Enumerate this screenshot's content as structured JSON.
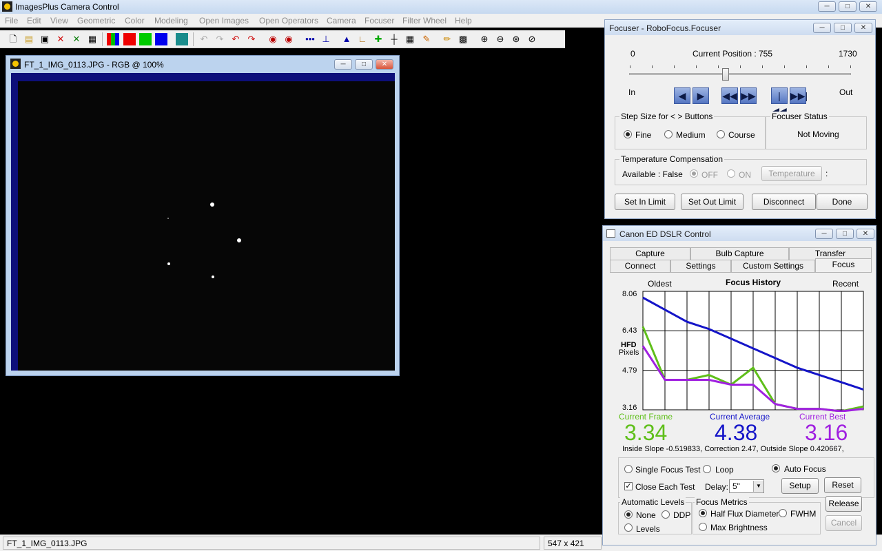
{
  "app": {
    "title": "ImagesPlus Camera Control"
  },
  "menu": [
    "File",
    "Edit",
    "View",
    "Geometric",
    "Color",
    "Modeling",
    "Open Images",
    "Open Operators",
    "Camera",
    "Focuser",
    "Filter Wheel",
    "Help"
  ],
  "toolbar": {
    "icons": [
      "new-file-icon",
      "open-folder-icon",
      "save-icon",
      "close-red-x-icon",
      "close-green-x-icon",
      "window-icon",
      "rgb-channels-icon",
      "red-channel-icon",
      "green-channel-icon",
      "blue-channel-icon",
      "stack-icon",
      "undo-gray-icon",
      "redo-gray-icon",
      "undo-icon",
      "redo-icon",
      "star-target-icon",
      "star-target-alt-icon",
      "dots-icon",
      "plot-icon",
      "histogram-icon",
      "curve-icon",
      "add-green-icon",
      "crosshair-icon",
      "grid-select-icon",
      "paint-icon",
      "pencil-icon",
      "calculator-icon",
      "zoom-in-icon",
      "zoom-out-icon",
      "zoom-fit-icon",
      "zoom-actual-icon"
    ]
  },
  "image_window": {
    "title": "FT_1_IMG_0113.JPG - RGB @ 100%"
  },
  "status": {
    "filename": "FT_1_IMG_0113.JPG",
    "dimensions": "547 x 421"
  },
  "focuser": {
    "title": "Focuser - RoboFocus.Focuser",
    "min": "0",
    "max": "1730",
    "current_label": "Current Position :",
    "current_value": "755",
    "position_fraction": 0.436,
    "in_label": "In",
    "out_label": "Out",
    "step_group": "Step Size for < > Buttons",
    "step_options": [
      "Fine",
      "Medium",
      "Course"
    ],
    "step_selected": "Fine",
    "status_group": "Focuser Status",
    "status_value": "Not Moving",
    "temp_group": "Temperature Compensation",
    "temp_available": "Available : False",
    "temp_off": "OFF",
    "temp_on": "ON",
    "temp_button": "Temperature",
    "temp_colon": ":",
    "buttons": {
      "set_in": "Set In Limit",
      "set_out": "Set Out Limit",
      "disconnect": "Disconnect",
      "done": "Done"
    }
  },
  "dslr": {
    "title": "Canon ED DSLR Control",
    "tabs_row1": [
      "Capture",
      "Bulb Capture",
      "Transfer"
    ],
    "tabs_row2": [
      "Connect",
      "Settings",
      "Custom Settings",
      "Focus"
    ],
    "active_tab": "Focus",
    "oldest": "Oldest",
    "recent": "Recent",
    "current_frame_label": "Current Frame",
    "current_frame_value": "3.34",
    "current_avg_label": "Current Average",
    "current_avg_value": "4.38",
    "current_best_label": "Current Best",
    "current_best_value": "3.16",
    "slope_text": "Inside Slope -0.519833, Correction  2.47, Outside Slope 0.420667,",
    "single_focus": "Single Focus Test",
    "loop": "Loop",
    "auto_focus": "Auto Focus",
    "close_each": "Close Each Test",
    "delay_label": "Delay:",
    "delay_value": "5\"",
    "setup": "Setup",
    "reset": "Reset",
    "release": "Release",
    "cancel": "Cancel",
    "auto_levels_group": "Automatic Levels",
    "auto_levels": [
      "None",
      "DDP",
      "Levels"
    ],
    "auto_levels_selected": "None",
    "metrics_group": "Focus Metrics",
    "metrics": [
      "Half Flux Diameter",
      "FWHM",
      "Max Brightness"
    ],
    "metrics_selected": "Half Flux Diameter",
    "colors": {
      "frame": "#5fbf1a",
      "average": "#1515c8",
      "best": "#a020e0"
    }
  },
  "chart_data": {
    "type": "line",
    "title": "Focus History",
    "ylabel_line1": "HFD",
    "ylabel_line2": "Pixels",
    "yticks": [
      "8.06",
      "6.43",
      "4.79",
      "3.16"
    ],
    "ylim": [
      3.16,
      8.06
    ],
    "x": [
      0,
      1,
      2,
      3,
      4,
      5,
      6,
      7,
      8,
      9,
      10
    ],
    "series": [
      {
        "name": "Current Average",
        "color": "#1515c8",
        "values": [
          7.8,
          7.3,
          6.8,
          6.5,
          6.1,
          5.7,
          5.3,
          4.9,
          4.6,
          4.3,
          4.0
        ]
      },
      {
        "name": "Current Frame",
        "color": "#5fbf1a",
        "values": [
          6.6,
          4.4,
          4.4,
          4.6,
          4.2,
          4.9,
          3.4,
          3.2,
          3.2,
          3.1,
          3.3
        ]
      },
      {
        "name": "Current Best",
        "color": "#a020e0",
        "values": [
          5.8,
          4.4,
          4.4,
          4.4,
          4.2,
          4.2,
          3.4,
          3.2,
          3.2,
          3.1,
          3.2
        ]
      }
    ]
  }
}
